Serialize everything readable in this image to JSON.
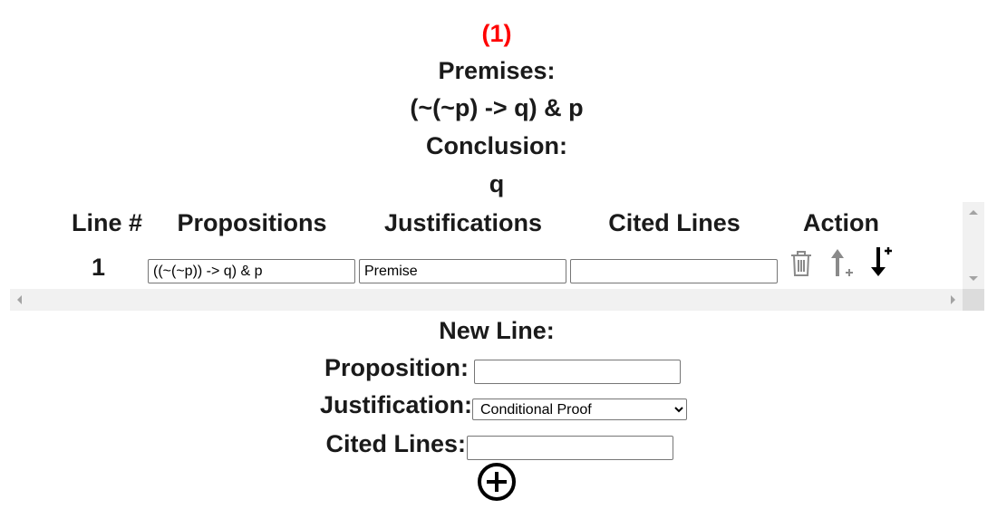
{
  "problem": {
    "number": "(1)",
    "premises_label": "Premises:",
    "premises": "(~(~p) -> q) & p",
    "conclusion_label": "Conclusion:",
    "conclusion": "q"
  },
  "table": {
    "headers": [
      "Line #",
      "Propositions",
      "Justifications",
      "Cited Lines",
      "Action"
    ],
    "rows": [
      {
        "line": "1",
        "proposition": "((~(~p)) -> q) & p",
        "justification": "Premise",
        "cited": ""
      }
    ],
    "action_icons": [
      "trash-icon",
      "insert-above-icon",
      "insert-below-icon"
    ]
  },
  "new_line": {
    "title": "New Line:",
    "proposition_label": "Proposition:",
    "proposition_value": "",
    "justification_label": "Justification:",
    "justification_value": "Conditional Proof",
    "cited_label": "Cited Lines:",
    "cited_value": "",
    "add_icon": "plus-circle-icon"
  },
  "colors": {
    "number": "#ff0000"
  }
}
